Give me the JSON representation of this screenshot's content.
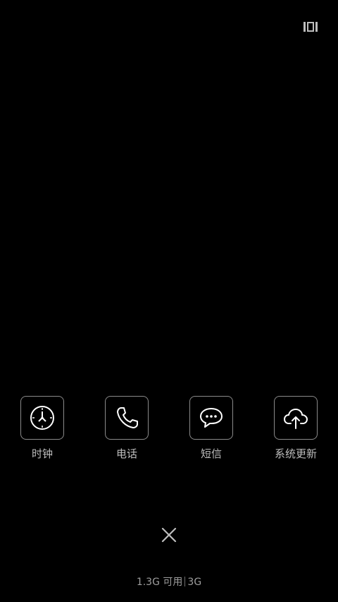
{
  "top_bar": {
    "toggle_icon": "view-toggle-icon"
  },
  "apps": [
    {
      "label": "时钟",
      "icon": "clock-icon"
    },
    {
      "label": "电话",
      "icon": "phone-icon"
    },
    {
      "label": "短信",
      "icon": "message-icon"
    },
    {
      "label": "系统更新",
      "icon": "cloud-upload-icon"
    }
  ],
  "close": {
    "icon": "close-icon"
  },
  "memory": {
    "available": "1.3G 可用",
    "total": "3G"
  },
  "colors": {
    "background": "#000000",
    "icon_stroke": "#ffffff",
    "border": "#8a8a8a",
    "label": "#bdbdbd"
  }
}
